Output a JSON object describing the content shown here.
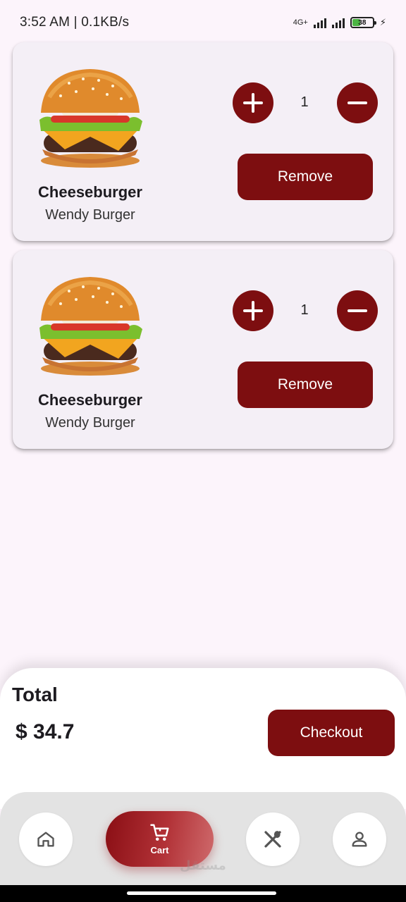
{
  "status_bar": {
    "time_speed": "3:52 AM | 0.1KB/s",
    "network": "4G+",
    "battery": "38"
  },
  "cart_items": [
    {
      "name": "Cheeseburger",
      "store": "Wendy Burger",
      "quantity": "1",
      "remove_label": "Remove"
    },
    {
      "name": "Cheeseburger",
      "store": "Wendy Burger",
      "quantity": "1",
      "remove_label": "Remove"
    }
  ],
  "summary": {
    "total_label": "Total",
    "total_value": "$ 34.7",
    "checkout_label": "Checkout"
  },
  "nav": {
    "cart_label": "Cart",
    "items": [
      "home-icon",
      "cart-icon",
      "restaurant-icon",
      "profile-icon"
    ]
  },
  "watermark": "مستقل",
  "colors": {
    "accent": "#7d0e10",
    "background": "#fcf4fb",
    "card": "#f4eff6",
    "nav_bar": "#e3e3e3"
  }
}
